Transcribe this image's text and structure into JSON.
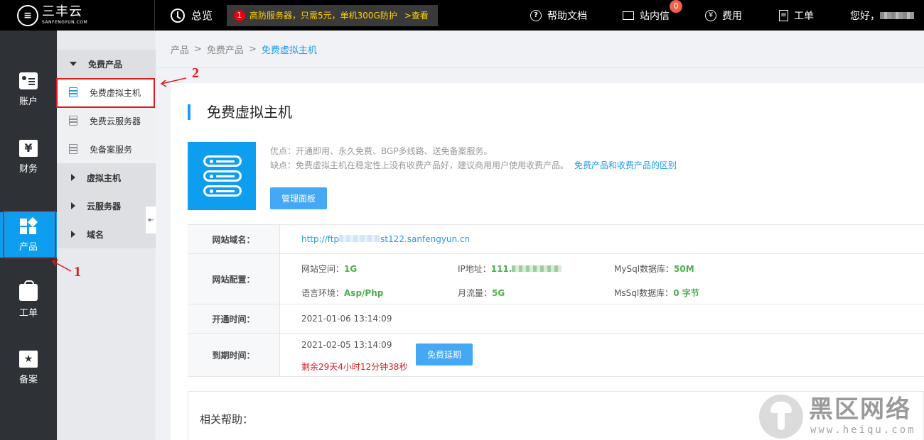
{
  "header": {
    "logo_name": "三丰云",
    "logo_sub": "SANFENGYUN.COM",
    "overview": "总览",
    "promo_num": "1",
    "promo_text": "高防服务器，只需5元，单机300G防护",
    "promo_link": ">查看",
    "help_docs": "帮助文档",
    "messages": "站内信",
    "messages_count": "0",
    "fees": "费用",
    "tickets": "工单",
    "greeting": "您好，"
  },
  "leftnav": {
    "items": [
      {
        "label": "账户",
        "icon": "account-card-icon"
      },
      {
        "label": "财务",
        "icon": "yen-icon"
      },
      {
        "label": "产品",
        "icon": "product-blocks-icon"
      },
      {
        "label": "工单",
        "icon": "bag-icon"
      },
      {
        "label": "备案",
        "icon": "star-badge-icon"
      }
    ],
    "active_color": "#0e9ef0"
  },
  "subnav": {
    "group_free": "免费产品",
    "items_free": [
      "免费虚拟主机",
      "免费云服务器",
      "免备案服务"
    ],
    "group_vhost": "虚拟主机",
    "group_cloud": "云服务器",
    "group_domain": "域名"
  },
  "annotations": {
    "one": "1",
    "two": "2"
  },
  "breadcrumb": [
    "产品",
    "免费产品",
    "免费虚拟主机"
  ],
  "main": {
    "title": "免费虚拟主机",
    "pros": "优点：开通即用、永久免费、BGP多线路、送免备案服务。",
    "cons": "缺点：免费虚拟主机在稳定性上没有收费产品好，建议商用用户使用收费产品。",
    "cons_link": "免费产品和收费产品的区别",
    "manage_button": "管理面板",
    "domain_label": "网站域名：",
    "domain_value_start": "http://ftp",
    "domain_value_end": "st122.sanfengyun.cn",
    "config_label": "网站配置：",
    "space_label": "网站空间：",
    "space_value": "1G",
    "ip_label": "IP地址：",
    "ip_value": "111.",
    "mysql_label": "MySql数据库：",
    "mysql_value": "50M",
    "lang_label": "语言环境：",
    "lang_value": "Asp/Php",
    "traffic_label": "月流量：",
    "traffic_value": "5G",
    "mssql_label": "MsSql数据库：",
    "mssql_value": "0 字节",
    "open_label": "开通时间：",
    "open_value": "2021-01-06 13:14:09",
    "expire_label": "到期时间：",
    "expire_value": "2021-02-05 13:14:09",
    "remaining": "剩余29天4小时12分钟38秒",
    "extend_button": "免费延期",
    "help_title": "相关帮助："
  },
  "watermark": {
    "name": "黑区网络",
    "url": "www.heiqu.com"
  }
}
